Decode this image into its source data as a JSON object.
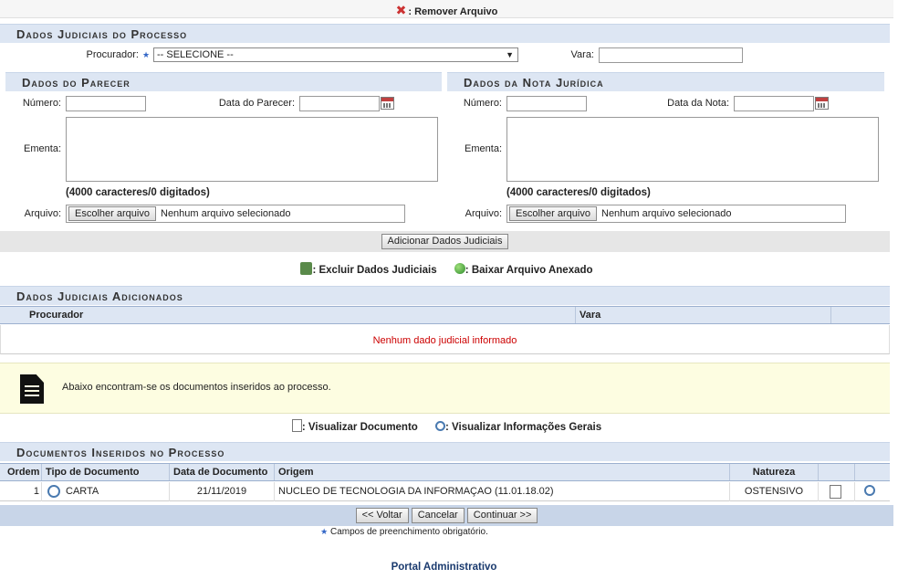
{
  "remove": {
    "label": ": Remover Arquivo"
  },
  "dados_processo": {
    "title": "Dados Judiciais do Processo",
    "procurador_label": "Procurador:",
    "procurador_value": "-- SELECIONE --",
    "vara_label": "Vara:"
  },
  "parecer": {
    "title": "Dados do Parecer",
    "numero_label": "Número:",
    "data_label": "Data do Parecer:",
    "ementa_label": "Ementa:",
    "counter": "(4000 caracteres/0 digitados)",
    "arquivo_label": "Arquivo:",
    "file_button": "Escolher arquivo",
    "file_status": "Nenhum arquivo selecionado"
  },
  "nota": {
    "title": "Dados da Nota Jurídica",
    "numero_label": "Número:",
    "data_label": "Data da Nota:",
    "ementa_label": "Ementa:",
    "counter": "(4000 caracteres/0 digitados)",
    "arquivo_label": "Arquivo:",
    "file_button": "Escolher arquivo",
    "file_status": "Nenhum arquivo selecionado"
  },
  "add_button": "Adicionar Dados Judiciais",
  "legend1": {
    "excluir": ": Excluir Dados Judiciais",
    "baixar": ": Baixar Arquivo Anexado"
  },
  "adicionados": {
    "title": "Dados Judiciais Adicionados",
    "col_procurador": "Procurador",
    "col_vara": "Vara",
    "empty": "Nenhum dado judicial informado"
  },
  "info_text": "Abaixo encontram-se os documentos inseridos ao processo.",
  "legend2": {
    "visualizar_doc": ": Visualizar Documento",
    "visualizar_info": ": Visualizar Informações Gerais"
  },
  "documentos": {
    "title": "Documentos Inseridos no Processo",
    "columns": [
      "Ordem",
      "Tipo de Documento",
      "Data de Documento",
      "Origem",
      "Natureza"
    ],
    "rows": [
      {
        "ordem": "1",
        "tipo": "CARTA",
        "data": "21/11/2019",
        "origem": "NUCLEO DE TECNOLOGIA DA INFORMAÇAO (11.01.18.02)",
        "natureza": "OSTENSIVO"
      }
    ]
  },
  "nav": {
    "voltar": "<< Voltar",
    "cancelar": "Cancelar",
    "continuar": "Continuar >>"
  },
  "required_note": "Campos de preenchimento obrigatório.",
  "footer": "Portal Administrativo",
  "colors": {
    "header_bg": "#dde6f3",
    "required_star": "#3367c7",
    "empty_msg": "#cc0000",
    "footer_link": "#1a3a6e"
  }
}
